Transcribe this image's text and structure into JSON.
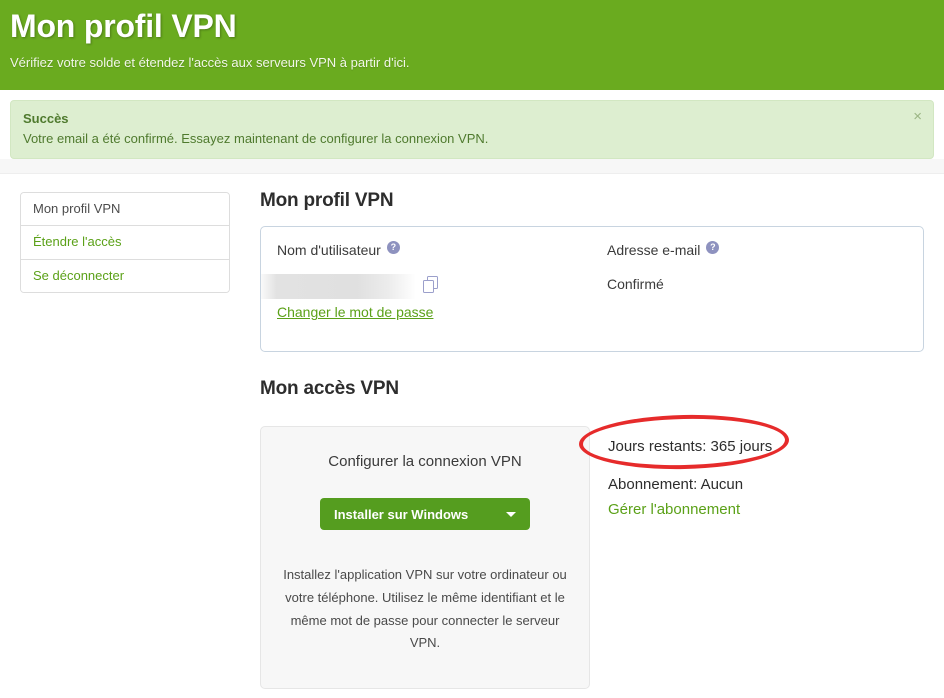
{
  "header": {
    "title": "Mon profil VPN",
    "subtitle": "Vérifiez votre solde et étendez l'accès aux serveurs VPN à partir d'ici.",
    "background_color": "#6aab1f"
  },
  "alert": {
    "type": "success",
    "title": "Succès",
    "message": "Votre email a été confirmé. Essayez maintenant de configurer la connexion VPN.",
    "close_label": "×",
    "background_color": "#ddeed0",
    "text_color": "#4f7a2e"
  },
  "sidebar": {
    "items": [
      {
        "label": "Mon profil VPN",
        "active": true
      },
      {
        "label": "Étendre l'accès",
        "active": false
      },
      {
        "label": "Se déconnecter",
        "active": false
      }
    ]
  },
  "profile": {
    "section_title": "Mon profil VPN",
    "username_label": "Nom d'utilisateur",
    "username_value": "",
    "username_help": "?",
    "copy_icon": "copy-icon",
    "change_password_link": "Changer le mot de passe",
    "email_label": "Adresse e-mail",
    "email_help": "?",
    "email_status": "Confirmé"
  },
  "vpn_access": {
    "section_title": "Mon accès VPN",
    "card_title": "Configurer la connexion VPN",
    "install_button": "Installer sur Windows",
    "install_button_color": "#559d1f",
    "description": "Installez l'application VPN sur votre ordinateur ou votre téléphone. Utilisez le même identifiant et le même mot de passe pour connecter le serveur VPN."
  },
  "subscription": {
    "days_remaining": "Jours restants: 365 jours",
    "plan": "Abonnement: Aucun",
    "manage_link": "Gérer l'abonnement",
    "highlight_color": "#e62b2b"
  }
}
